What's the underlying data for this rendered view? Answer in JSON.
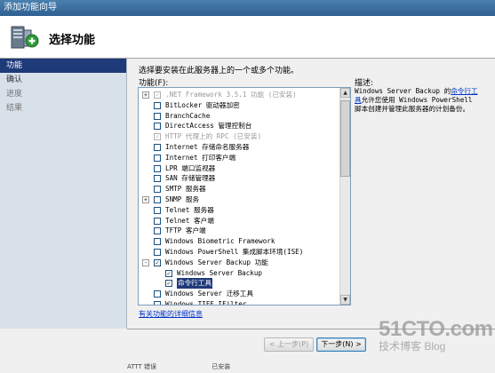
{
  "window": {
    "title": "添加功能向导"
  },
  "header": {
    "title": "选择功能"
  },
  "nav": {
    "items": [
      {
        "label": "功能",
        "state": "active"
      },
      {
        "label": "确认",
        "state": "normal"
      },
      {
        "label": "进度",
        "state": "dim"
      },
      {
        "label": "结果",
        "state": "dim"
      }
    ]
  },
  "main": {
    "instruction": "选择要安装在此服务器上的一个或多个功能。",
    "list_label": "功能(F):",
    "features": [
      {
        "label": ".NET Framework 3.5.1 功能  (已安装)",
        "expander": "+",
        "checked": true,
        "disabled": true,
        "indent": 0
      },
      {
        "label": "BitLocker 驱动器加密",
        "expander": "",
        "checked": false,
        "disabled": false,
        "indent": 0
      },
      {
        "label": "BranchCache",
        "expander": "",
        "checked": false,
        "disabled": false,
        "indent": 0
      },
      {
        "label": "DirectAccess 管理控制台",
        "expander": "",
        "checked": false,
        "disabled": false,
        "indent": 0
      },
      {
        "label": "HTTP 代理上的 RPC  (已安装)",
        "expander": "",
        "checked": true,
        "disabled": true,
        "indent": 0
      },
      {
        "label": "Internet 存储命名服务器",
        "expander": "",
        "checked": false,
        "disabled": false,
        "indent": 0
      },
      {
        "label": "Internet 打印客户端",
        "expander": "",
        "checked": false,
        "disabled": false,
        "indent": 0
      },
      {
        "label": "LPR 端口监视器",
        "expander": "",
        "checked": false,
        "disabled": false,
        "indent": 0
      },
      {
        "label": "SAN 存储管理器",
        "expander": "",
        "checked": false,
        "disabled": false,
        "indent": 0
      },
      {
        "label": "SMTP 服务器",
        "expander": "",
        "checked": false,
        "disabled": false,
        "indent": 0
      },
      {
        "label": "SNMP 服务",
        "expander": "+",
        "checked": false,
        "disabled": false,
        "indent": 0
      },
      {
        "label": "Telnet 服务器",
        "expander": "",
        "checked": false,
        "disabled": false,
        "indent": 0
      },
      {
        "label": "Telnet 客户端",
        "expander": "",
        "checked": false,
        "disabled": false,
        "indent": 0
      },
      {
        "label": "TFTP 客户端",
        "expander": "",
        "checked": false,
        "disabled": false,
        "indent": 0
      },
      {
        "label": "Windows Biometric Framework",
        "expander": "",
        "checked": false,
        "disabled": false,
        "indent": 0
      },
      {
        "label": "Windows PowerShell 集成脚本环境(ISE)",
        "expander": "",
        "checked": false,
        "disabled": false,
        "indent": 0
      },
      {
        "label": "Windows Server Backup 功能",
        "expander": "-",
        "checked": true,
        "disabled": false,
        "indent": 0
      },
      {
        "label": "Windows Server Backup",
        "expander": "",
        "checked": true,
        "disabled": false,
        "indent": 1
      },
      {
        "label": "命令行工具",
        "expander": "",
        "checked": true,
        "disabled": false,
        "indent": 1,
        "selected": true
      },
      {
        "label": "Windows Server 迁移工具",
        "expander": "",
        "checked": false,
        "disabled": false,
        "indent": 0
      },
      {
        "label": "Windows TIFF IFilter",
        "expander": "",
        "checked": false,
        "disabled": false,
        "indent": 0
      }
    ],
    "more_link": "有关功能的详细信息"
  },
  "description": {
    "label": "描述:",
    "text_before": "Windows Server Backup 的",
    "link": "命令行工具",
    "text_after": "允许您使用 Windows PowerShell 脚本创建并管理此服务器的计划备份。"
  },
  "buttons": {
    "prev": "< 上一步(P)",
    "next": "下一步(N) >"
  },
  "bottom_strip": {
    "left": "ATTT  错误",
    "right": "已安装"
  },
  "watermark": {
    "main": "51CTO.com",
    "sub": "技术博客  Blog"
  }
}
